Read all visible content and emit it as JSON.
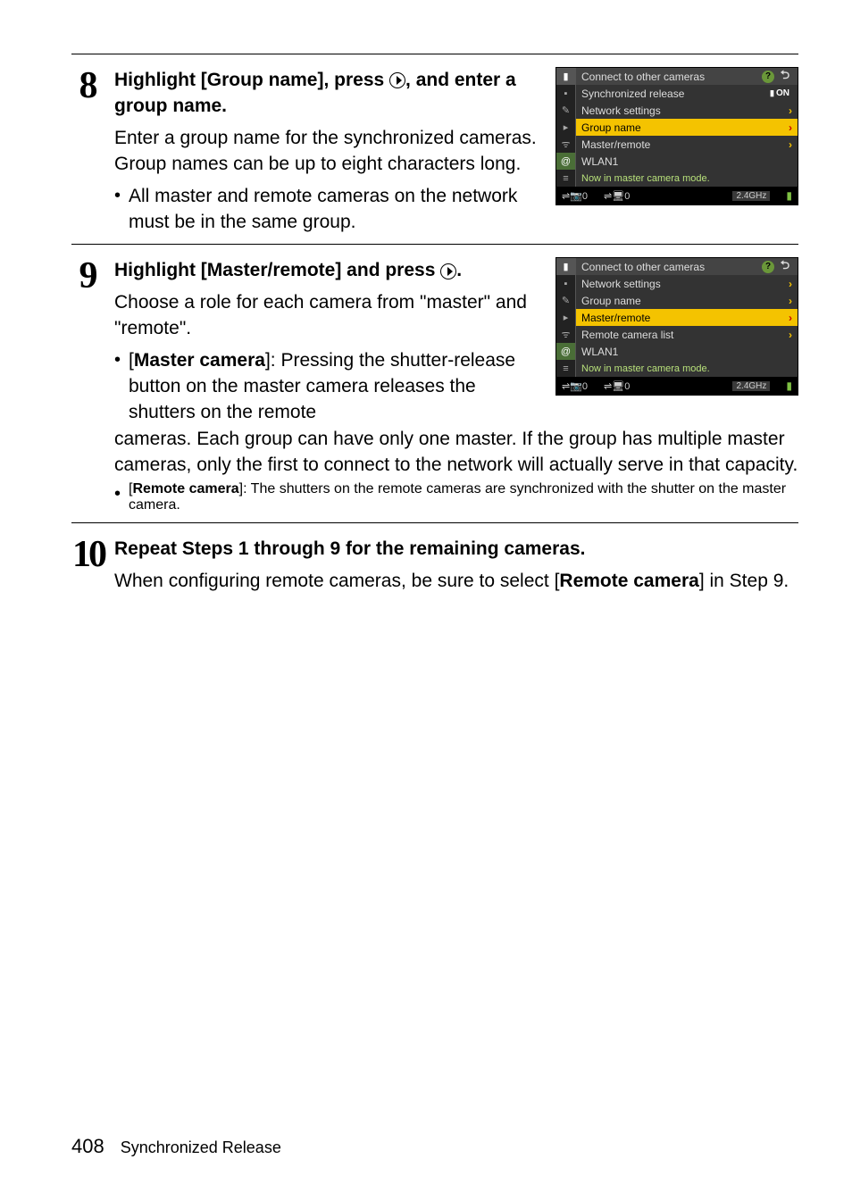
{
  "steps": {
    "s8": {
      "num": "8",
      "title_pre": "Highlight [Group name], press ",
      "title_post": ", and enter a group name.",
      "desc": "Enter a group name for the synchronized cameras. Group names can be up to eight characters long.",
      "bullet1": "All master and remote cameras on the network must be in the same group."
    },
    "s9": {
      "num": "9",
      "title_pre": "Highlight [Master/remote] and press ",
      "title_post": ".",
      "desc": "Choose a role for each camera from \"master\" and \"remote\".",
      "bullet1_label": "Master camera",
      "bullet1_text": "]: Pressing the shutter-release button on the master camera releases the shutters on the remote",
      "bullet1_cont": "cameras. Each group can have only one master. If the group has multiple master cameras, only the first to connect to the network will actually serve in that capacity.",
      "bullet2_label": "Remote camera",
      "bullet2_text": "]: The shutters on the remote cameras are synchronized with the shutter on the master camera."
    },
    "s10": {
      "num": "10",
      "title": "Repeat Steps 1 through 9 for the remaining cameras.",
      "desc_pre": "When configuring remote cameras, be sure to select [",
      "desc_bold": "Remote camera",
      "desc_post": "] in Step 9."
    }
  },
  "screenshot1": {
    "header": "Connect to other cameras",
    "rows": {
      "r1": "Synchronized release",
      "r1_badge": "ON",
      "r2": "Network settings",
      "r3": "Group name",
      "r4": "Master/remote"
    },
    "wlan": "WLAN1",
    "status": "Now in master camera mode.",
    "footer": {
      "cam": "⇌📷0",
      "pc": "⇌🖥0",
      "freq": "2.4GHz"
    }
  },
  "screenshot2": {
    "header": "Connect to other cameras",
    "rows": {
      "r1": "Network settings",
      "r2": "Group name",
      "r3": "Master/remote",
      "r4": "Remote camera list"
    },
    "wlan": "WLAN1",
    "status": "Now in master camera mode.",
    "footer": {
      "cam": "⇌📷0",
      "pc": "⇌🖥0",
      "freq": "2.4GHz"
    }
  },
  "footer": {
    "page": "408",
    "section": "Synchronized Release"
  }
}
